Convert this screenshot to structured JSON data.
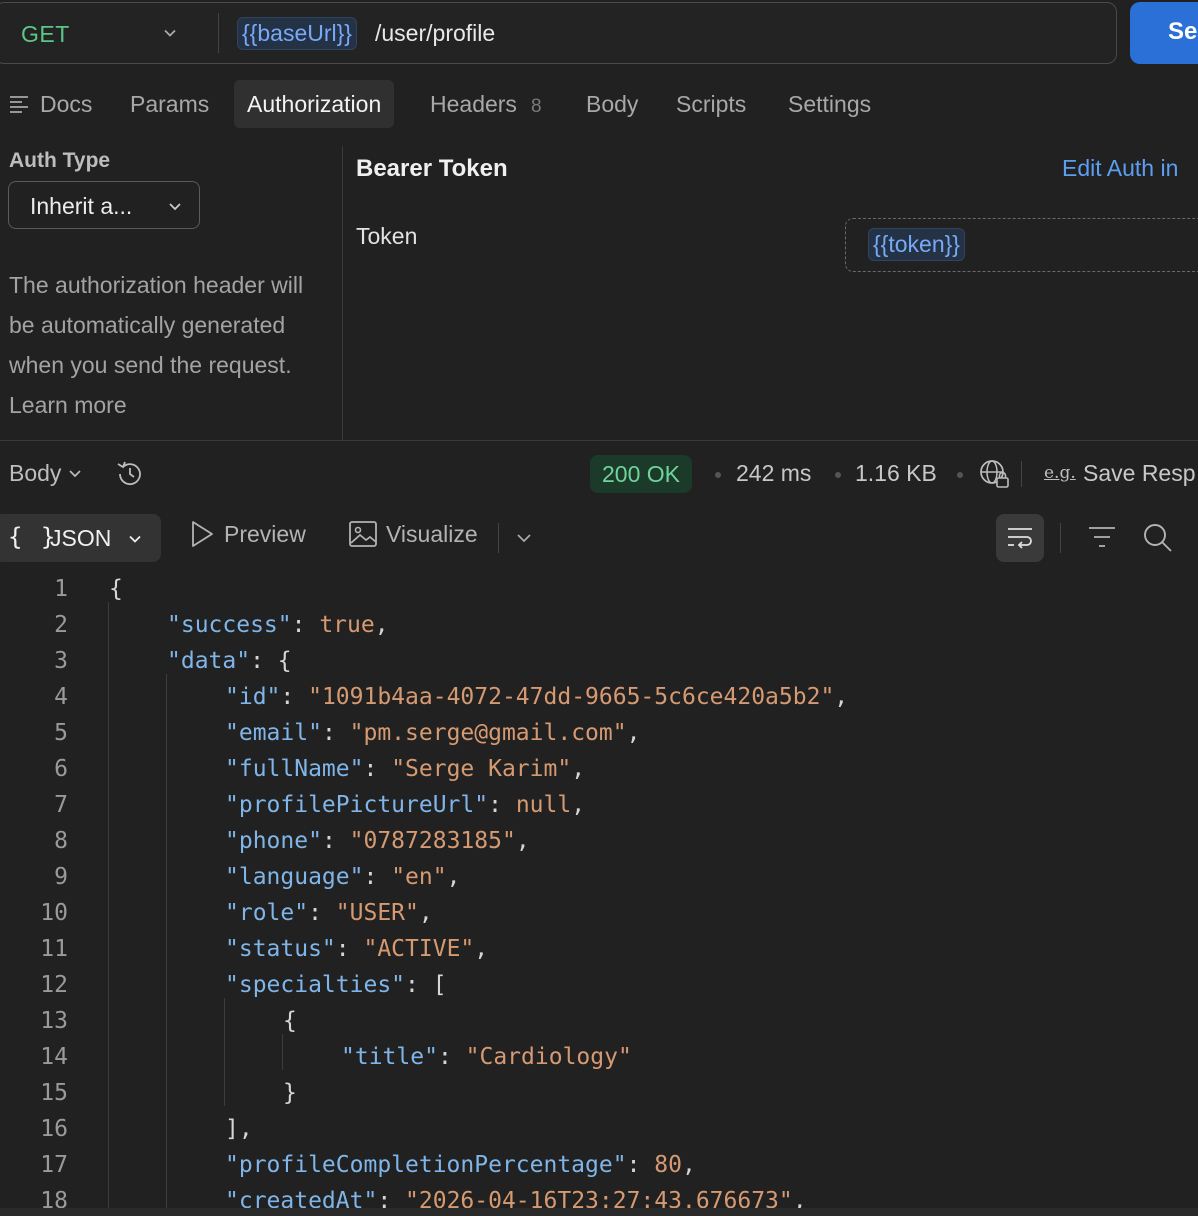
{
  "request": {
    "method": "GET",
    "url_variable": "{{baseUrl}}",
    "url_path": "/user/profile",
    "send_label": "Se"
  },
  "tabs": [
    {
      "label": "Docs"
    },
    {
      "label": "Params"
    },
    {
      "label": "Authorization"
    },
    {
      "label": "Headers",
      "count": "8"
    },
    {
      "label": "Body"
    },
    {
      "label": "Scripts"
    },
    {
      "label": "Settings"
    }
  ],
  "auth": {
    "type_label": "Auth Type",
    "type_value": "Inherit a...",
    "description": "The authorization header will be automatically generated when you send the request. Learn more",
    "bearer_title": "Bearer Token",
    "edit_link": "Edit Auth in",
    "token_label": "Token",
    "token_value": "{{token}}"
  },
  "response": {
    "body_label": "Body",
    "status": "200 OK",
    "time": "242 ms",
    "size": "1.16 KB",
    "example_icon": "e.g.",
    "save_label": "Save Resp",
    "format_label": "JSON",
    "format_braces": "{ }",
    "preview_label": "Preview",
    "visualize_label": "Visualize"
  },
  "icons": {
    "docs": "lines-icon",
    "history": "history-icon",
    "globe": "globe-lock-icon",
    "wrap": "wrap-lines-icon",
    "filter": "filter-icon",
    "search": "search-icon",
    "preview": "play-icon",
    "visualize": "image-icon"
  },
  "colors": {
    "accent": "#2b70d6",
    "method": "#5cc689",
    "status_ok": "#6fd39a",
    "json_key": "#7fb5e8",
    "json_value": "#d69a72"
  },
  "code_lines": [
    {
      "n": "1",
      "tokens": [
        {
          "t": "{",
          "c": "p"
        }
      ]
    },
    {
      "n": "2",
      "tokens": [
        {
          "t": "\"success\"",
          "c": "k"
        },
        {
          "t": ": ",
          "c": "p"
        },
        {
          "t": "true",
          "c": "v"
        },
        {
          "t": ",",
          "c": "p"
        }
      ]
    },
    {
      "n": "3",
      "tokens": [
        {
          "t": "\"data\"",
          "c": "k"
        },
        {
          "t": ": {",
          "c": "p"
        }
      ]
    },
    {
      "n": "4",
      "tokens": [
        {
          "t": "\"id\"",
          "c": "k"
        },
        {
          "t": ": ",
          "c": "p"
        },
        {
          "t": "\"1091b4aa-4072-47dd-9665-5c6ce420a5b2\"",
          "c": "s"
        },
        {
          "t": ",",
          "c": "p"
        }
      ]
    },
    {
      "n": "5",
      "tokens": [
        {
          "t": "\"email\"",
          "c": "k"
        },
        {
          "t": ": ",
          "c": "p"
        },
        {
          "t": "\"pm.serge@gmail.com\"",
          "c": "s"
        },
        {
          "t": ",",
          "c": "p"
        }
      ]
    },
    {
      "n": "6",
      "tokens": [
        {
          "t": "\"fullName\"",
          "c": "k"
        },
        {
          "t": ": ",
          "c": "p"
        },
        {
          "t": "\"Serge Karim\"",
          "c": "s"
        },
        {
          "t": ",",
          "c": "p"
        }
      ]
    },
    {
      "n": "7",
      "tokens": [
        {
          "t": "\"profilePictureUrl\"",
          "c": "k"
        },
        {
          "t": ": ",
          "c": "p"
        },
        {
          "t": "null",
          "c": "v"
        },
        {
          "t": ",",
          "c": "p"
        }
      ]
    },
    {
      "n": "8",
      "tokens": [
        {
          "t": "\"phone\"",
          "c": "k"
        },
        {
          "t": ": ",
          "c": "p"
        },
        {
          "t": "\"0787283185\"",
          "c": "s"
        },
        {
          "t": ",",
          "c": "p"
        }
      ]
    },
    {
      "n": "9",
      "tokens": [
        {
          "t": "\"language\"",
          "c": "k"
        },
        {
          "t": ": ",
          "c": "p"
        },
        {
          "t": "\"en\"",
          "c": "s"
        },
        {
          "t": ",",
          "c": "p"
        }
      ]
    },
    {
      "n": "10",
      "tokens": [
        {
          "t": "\"role\"",
          "c": "k"
        },
        {
          "t": ": ",
          "c": "p"
        },
        {
          "t": "\"USER\"",
          "c": "s"
        },
        {
          "t": ",",
          "c": "p"
        }
      ]
    },
    {
      "n": "11",
      "tokens": [
        {
          "t": "\"status\"",
          "c": "k"
        },
        {
          "t": ": ",
          "c": "p"
        },
        {
          "t": "\"ACTIVE\"",
          "c": "s"
        },
        {
          "t": ",",
          "c": "p"
        }
      ]
    },
    {
      "n": "12",
      "tokens": [
        {
          "t": "\"specialties\"",
          "c": "k"
        },
        {
          "t": ": [",
          "c": "p"
        }
      ]
    },
    {
      "n": "13",
      "tokens": [
        {
          "t": "{",
          "c": "p"
        }
      ]
    },
    {
      "n": "14",
      "tokens": [
        {
          "t": "\"title\"",
          "c": "k"
        },
        {
          "t": ": ",
          "c": "p"
        },
        {
          "t": "\"Cardiology\"",
          "c": "s"
        }
      ]
    },
    {
      "n": "15",
      "tokens": [
        {
          "t": "}",
          "c": "p"
        }
      ]
    },
    {
      "n": "16",
      "tokens": [
        {
          "t": "],",
          "c": "p"
        }
      ]
    },
    {
      "n": "17",
      "tokens": [
        {
          "t": "\"profileCompletionPercentage\"",
          "c": "k"
        },
        {
          "t": ": ",
          "c": "p"
        },
        {
          "t": "80",
          "c": "v"
        },
        {
          "t": ",",
          "c": "p"
        }
      ]
    },
    {
      "n": "18",
      "tokens": [
        {
          "t": "\"createdAt\"",
          "c": "k"
        },
        {
          "t": ": ",
          "c": "p"
        },
        {
          "t": "\"2026-04-16T23:27:43.676673\"",
          "c": "s"
        },
        {
          "t": ",",
          "c": "p"
        }
      ]
    }
  ]
}
